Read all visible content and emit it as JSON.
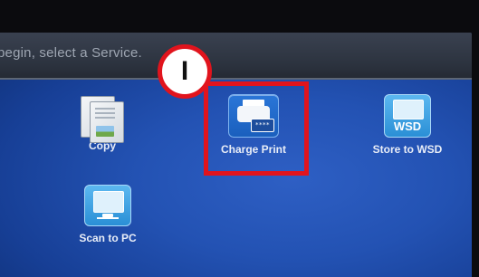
{
  "header": {
    "instruction": "begin, select a Service."
  },
  "services": [
    {
      "label": "Copy",
      "icon": "copy-icon"
    },
    {
      "label": "Charge Print",
      "icon": "printer-icon",
      "keypad_text": "****"
    },
    {
      "label": "Store to WSD",
      "icon": "wsd-icon",
      "icon_text": "WSD"
    },
    {
      "label": "Scan to PC",
      "icon": "monitor-icon"
    }
  ],
  "annotation": {
    "step": "I",
    "color": "#e1141d"
  }
}
